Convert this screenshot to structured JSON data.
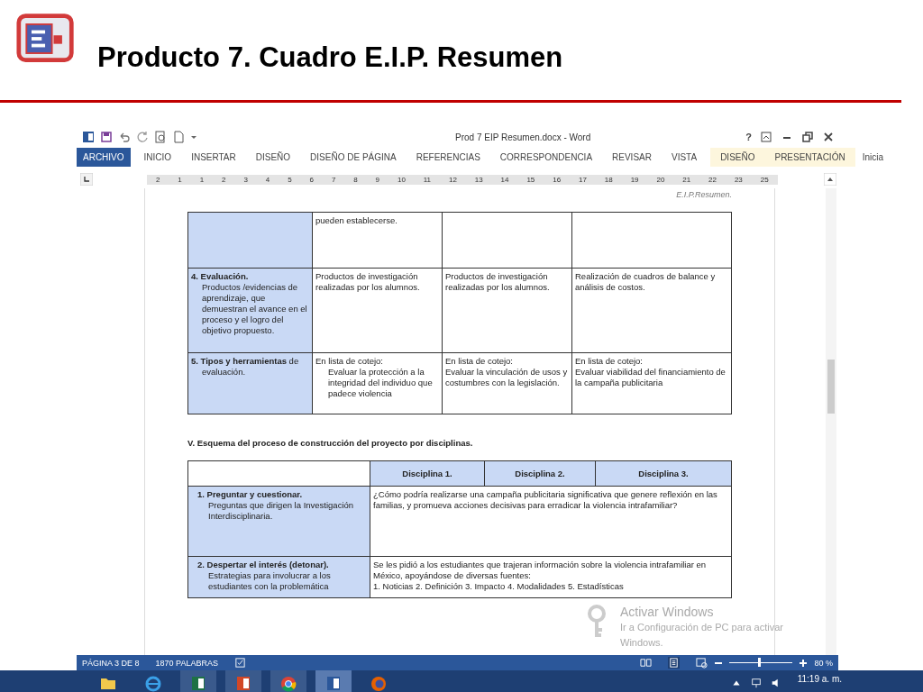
{
  "slide": {
    "title": "Producto 7. Cuadro E.I.P. Resumen"
  },
  "window": {
    "title": "Prod 7 EIP Resumen.docx - Word",
    "help": "?"
  },
  "tabs": [
    {
      "label": "ARCHIVO",
      "selected": true,
      "contextual": false
    },
    {
      "label": "INICIO",
      "selected": false,
      "contextual": false
    },
    {
      "label": "INSERTAR",
      "selected": false,
      "contextual": false
    },
    {
      "label": "DISEÑO",
      "selected": false,
      "contextual": false
    },
    {
      "label": "DISEÑO DE PÁGINA",
      "selected": false,
      "contextual": false
    },
    {
      "label": "REFERENCIAS",
      "selected": false,
      "contextual": false
    },
    {
      "label": "CORRESPONDENCIA",
      "selected": false,
      "contextual": false
    },
    {
      "label": "REVISAR",
      "selected": false,
      "contextual": false
    },
    {
      "label": "VISTA",
      "selected": false,
      "contextual": false
    },
    {
      "label": "DISEÑO",
      "selected": false,
      "contextual": true
    },
    {
      "label": "PRESENTACIÓN",
      "selected": false,
      "contextual": true
    },
    {
      "label": "Inicia",
      "selected": false,
      "contextual": false
    }
  ],
  "ruler_numbers": [
    "2",
    "1",
    "1",
    "2",
    "3",
    "4",
    "5",
    "6",
    "7",
    "8",
    "9",
    "10",
    "11",
    "12",
    "13",
    "14",
    "15",
    "16",
    "17",
    "18",
    "19",
    "20",
    "21",
    "22",
    "23",
    "25"
  ],
  "document": {
    "header": "E.I.P.Resumen.",
    "table_1": [
      {
        "cells": [
          "pueden establecerse.",
          "",
          ""
        ]
      },
      {
        "label": "**4. Evaluación.**",
        "detail": "Productos /evidencias de aprendizaje, que demuestran el avance en el proceso y el logro del objetivo   propuesto.",
        "cells": [
          "Productos de investigación realizadas por los alumnos.",
          "Productos de investigación realizadas por los alumnos.",
          "Realización de cuadros de balance y análisis de costos."
        ]
      },
      {
        "label": "**5. Tipos y herramientas** de",
        "detail": "evaluación.",
        "cells": [
          "En lista de cotejo:\nEvaluar la protección a la integridad del individuo que padece violencia",
          "En lista de cotejo:\nEvaluar la vinculación de usos y costumbres con la legislación.",
          "En lista de cotejo:\nEvaluar viabilidad del financiamiento de la campaña publicitaria"
        ]
      }
    ],
    "section_heading": "V. Esquema del proceso de construcción del proyecto por disciplinas.",
    "table_2": {
      "columns": [
        "Disciplina 1.",
        "Disciplina 2.",
        "Disciplina 3."
      ],
      "rows": [
        {
          "label": "1. Preguntar y cuestionar.",
          "detail": "Preguntas que dirigen la Investigación Interdisciplinaria.",
          "content": "¿Cómo podría realizarse una campaña publicitaria significativa que genere reflexión en las familias, y promueva acciones decisivas para erradicar la violencia intrafamiliar?"
        },
        {
          "label": "2. Despertar el interés (detonar).",
          "detail": "Estrategias para involucrar a los estudiantes con la problemática",
          "content": "Se les pidió a los estudiantes que trajeran información sobre la violencia intrafamiliar en México, apoyándose de diversas fuentes:\n1. Noticias 2. Definición 3. Impacto 4. Modalidades 5. Estadísticas"
        }
      ]
    }
  },
  "activation": [
    "Activar Windows",
    "Ir a Configuración de PC para activar",
    "Windows."
  ],
  "status_bar": {
    "page": "PÁGINA 3 DE 8",
    "words": "1870 PALABRAS",
    "zoom": {
      "level": 0.45
    },
    "zoom_reading": "80 %"
  },
  "taskbar": {
    "apps": [
      {
        "kind": "folder",
        "selected": false
      },
      {
        "kind": "ie",
        "selected": false
      },
      {
        "kind": "excel",
        "selected": false
      },
      {
        "kind": "powerpoint",
        "selected": false
      },
      {
        "kind": "chrome",
        "selected": false
      },
      {
        "kind": "word",
        "selected": true
      },
      {
        "kind": "firefox",
        "selected": false
      }
    ],
    "time": "11:19 a. m."
  }
}
